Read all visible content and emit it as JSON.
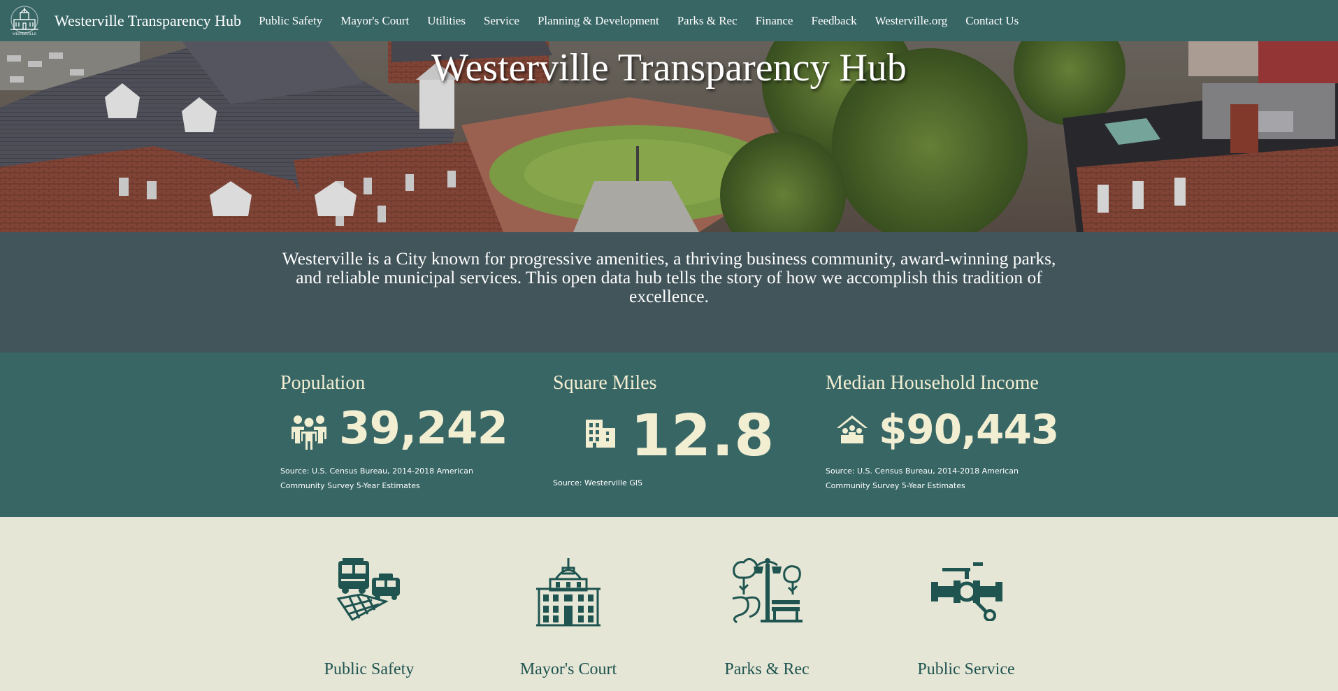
{
  "nav": {
    "logo": {
      "icon": "city-hall-logo",
      "text": "WESTERVILLE"
    },
    "site_title": "Westerville Transparency Hub",
    "links": [
      "Public Safety",
      "Mayor's Court",
      "Utilities",
      "Service",
      "Planning & Development",
      "Parks & Rec",
      "Finance",
      "Feedback",
      "Westerville.org",
      "Contact Us"
    ]
  },
  "hero": {
    "title": "Westerville Transparency Hub"
  },
  "intro": {
    "text": "Westerville is a City known for progressive amenities, a thriving business community, award-winning parks, and reliable municipal services. This open data hub tells the story of how we accomplish this tradition of excellence."
  },
  "stats": [
    {
      "title": "Population",
      "value": "39,242",
      "icon": "people-icon",
      "source": "Source: U.S. Census Bureau, 2014-2018 American Community Survey 5-Year Estimates"
    },
    {
      "title": "Square Miles",
      "value": "12.8",
      "icon": "building-icon",
      "source": "Source: Westerville GIS"
    },
    {
      "title": "Median Household Income",
      "value": "$90,443",
      "icon": "household-icon",
      "source": "Source: U.S. Census Bureau, 2014-2018 American Community Survey 5-Year Estimates"
    }
  ],
  "categories": [
    {
      "label": "Public Safety",
      "icon": "fire-truck-police-car-icon"
    },
    {
      "label": "Mayor's Court",
      "icon": "courthouse-icon"
    },
    {
      "label": "Parks & Rec",
      "icon": "park-lamp-bench-icon"
    },
    {
      "label": "Public Service",
      "icon": "water-pipe-valve-icon"
    }
  ],
  "colors": {
    "nav_bg": "#386665",
    "intro_bg": "#42555b",
    "stats_bg": "#386665",
    "stat_text": "#f2eed2",
    "page_bg": "#e6e6d6",
    "icon_green": "#1f5450"
  }
}
